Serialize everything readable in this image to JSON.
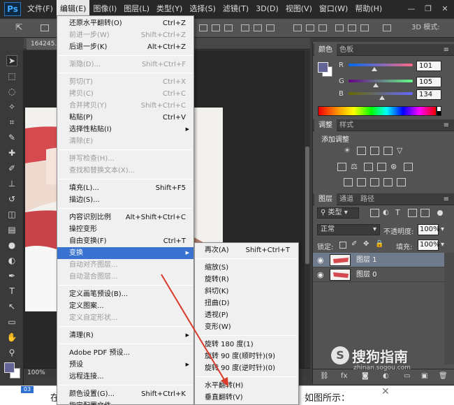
{
  "app": {
    "logo": "Ps"
  },
  "menubar": {
    "items": [
      "文件(F)",
      "编辑(E)",
      "图像(I)",
      "图层(L)",
      "类型(Y)",
      "选择(S)",
      "滤镜(T)",
      "3D(D)",
      "视图(V)",
      "窗口(W)",
      "帮助(H)"
    ],
    "active_index": 1
  },
  "options_bar": {
    "mode_3d": "3D 模式:"
  },
  "document": {
    "tab_name": "164245...",
    "zoom": "100%"
  },
  "edit_menu": {
    "items": [
      {
        "label": "还原水平翻转(O)",
        "shortcut": "Ctrl+Z",
        "disabled": false
      },
      {
        "label": "前进一步(W)",
        "shortcut": "Shift+Ctrl+Z",
        "disabled": true
      },
      {
        "label": "后退一步(K)",
        "shortcut": "Alt+Ctrl+Z",
        "disabled": false
      },
      {
        "label": "渐隐(D)...",
        "shortcut": "Shift+Ctrl+F",
        "disabled": true
      },
      {
        "label": "剪切(T)",
        "shortcut": "Ctrl+X",
        "disabled": true
      },
      {
        "label": "拷贝(C)",
        "shortcut": "Ctrl+C",
        "disabled": true
      },
      {
        "label": "合并拷贝(Y)",
        "shortcut": "Shift+Ctrl+C",
        "disabled": true
      },
      {
        "label": "粘贴(P)",
        "shortcut": "Ctrl+V",
        "disabled": false
      },
      {
        "label": "选择性粘贴(I)",
        "shortcut": "",
        "disabled": false,
        "submenu": true
      },
      {
        "label": "清除(E)",
        "shortcut": "",
        "disabled": true
      },
      {
        "label": "拼写检查(H)...",
        "shortcut": "",
        "disabled": true
      },
      {
        "label": "查找和替换文本(X)...",
        "shortcut": "",
        "disabled": true
      },
      {
        "label": "填充(L)...",
        "shortcut": "Shift+F5",
        "disabled": false
      },
      {
        "label": "描边(S)...",
        "shortcut": "",
        "disabled": false
      },
      {
        "label": "内容识别比例",
        "shortcut": "Alt+Shift+Ctrl+C",
        "disabled": false
      },
      {
        "label": "操控变形",
        "shortcut": "",
        "disabled": false
      },
      {
        "label": "自由变换(F)",
        "shortcut": "Ctrl+T",
        "disabled": false
      },
      {
        "label": "变换",
        "shortcut": "",
        "disabled": false,
        "submenu": true,
        "highlight": true
      },
      {
        "label": "自动对齐图层...",
        "shortcut": "",
        "disabled": true
      },
      {
        "label": "自动混合图层...",
        "shortcut": "",
        "disabled": true
      },
      {
        "label": "定义画笔预设(B)...",
        "shortcut": "",
        "disabled": false
      },
      {
        "label": "定义图案...",
        "shortcut": "",
        "disabled": false
      },
      {
        "label": "定义自定形状...",
        "shortcut": "",
        "disabled": true
      },
      {
        "label": "清理(R)",
        "shortcut": "",
        "disabled": false,
        "submenu": true
      },
      {
        "label": "Adobe PDF 预设...",
        "shortcut": "",
        "disabled": false
      },
      {
        "label": "预设",
        "shortcut": "",
        "disabled": false,
        "submenu": true
      },
      {
        "label": "远程连接...",
        "shortcut": "",
        "disabled": false
      },
      {
        "label": "颜色设置(G)...",
        "shortcut": "Shift+Ctrl+K",
        "disabled": false
      },
      {
        "label": "指定配置文件...",
        "shortcut": "",
        "disabled": false
      }
    ]
  },
  "transform_submenu": {
    "items": [
      {
        "label": "再次(A)",
        "shortcut": "Shift+Ctrl+T"
      },
      {
        "label": "缩放(S)",
        "shortcut": ""
      },
      {
        "label": "旋转(R)",
        "shortcut": ""
      },
      {
        "label": "斜切(K)",
        "shortcut": ""
      },
      {
        "label": "扭曲(D)",
        "shortcut": ""
      },
      {
        "label": "透视(P)",
        "shortcut": ""
      },
      {
        "label": "变形(W)",
        "shortcut": ""
      },
      {
        "label": "旋转 180 度(1)",
        "shortcut": ""
      },
      {
        "label": "旋转 90 度(顺时针)(9)",
        "shortcut": ""
      },
      {
        "label": "旋转 90 度(逆时针)(0)",
        "shortcut": ""
      },
      {
        "label": "水平翻转(H)",
        "shortcut": ""
      },
      {
        "label": "垂直翻转(V)",
        "shortcut": ""
      }
    ]
  },
  "color_panel": {
    "tabs": [
      "颜色",
      "色板"
    ],
    "channels": [
      {
        "label": "R",
        "value": "101"
      },
      {
        "label": "G",
        "value": "105"
      },
      {
        "label": "B",
        "value": "134"
      }
    ],
    "foreground_color": "#656496",
    "background_color": "#ffffff"
  },
  "adjustments_panel": {
    "tabs": [
      "调整",
      "样式"
    ],
    "title": "添加调整"
  },
  "layers_panel": {
    "tabs": [
      "图层",
      "通道",
      "路径"
    ],
    "filter_label": "类型",
    "blend_mode": "正常",
    "opacity_label": "不透明度:",
    "opacity_value": "100%",
    "lock_label": "锁定:",
    "fill_label": "填充:",
    "fill_value": "100%",
    "layers": [
      {
        "name": "图层 1",
        "selected": true
      },
      {
        "name": "图层 0",
        "selected": false
      }
    ]
  },
  "article": {
    "badge": "03",
    "left_text": "在",
    "right_text": "如图所示："
  },
  "watermark": {
    "text": "搜狗指南",
    "url": "zhinan.sogou.com",
    "mark": "S"
  },
  "colors": {
    "menu_highlight": "#3a72d1",
    "annotation_arrow": "#d93a2b"
  }
}
